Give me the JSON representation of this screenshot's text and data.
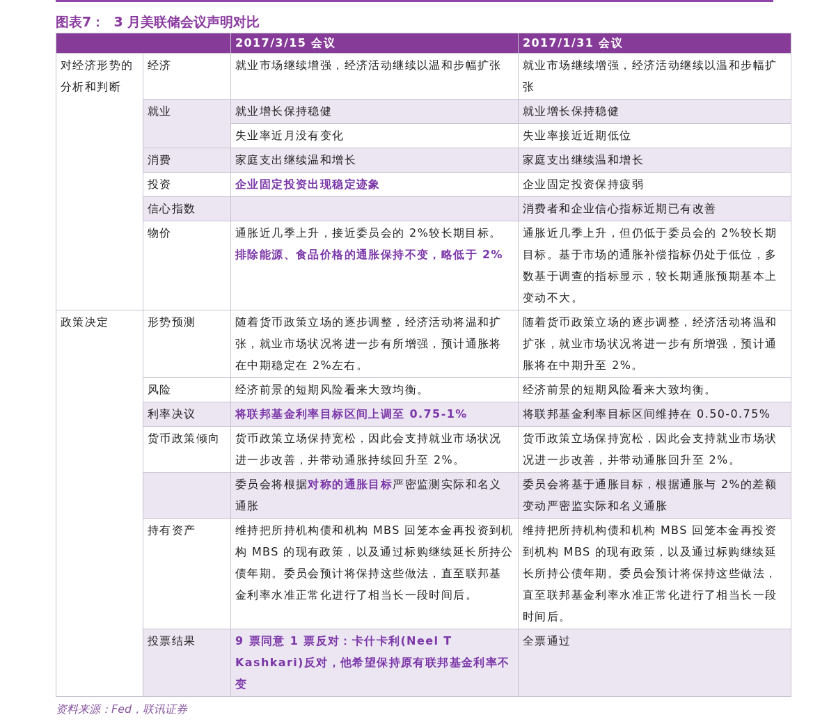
{
  "title": "图表7：  3 月美联储会议声明对比",
  "columns": [
    "2017/3/15 会议",
    "2017/1/31 会议"
  ],
  "groups": [
    {
      "label": "对经济形势的分析和判断",
      "topics": [
        {
          "label": "经济",
          "entries": [
            {
              "shaded": false,
              "cells": [
                {
                  "text": "就业市场继续增强，经济活动继续以温和步幅扩张",
                  "emphasis": false
                },
                {
                  "text": "就业市场继续增强，经济活动继续以温和步幅扩张",
                  "emphasis": false
                }
              ]
            }
          ]
        },
        {
          "label": "就业",
          "entries": [
            {
              "shaded": true,
              "cells": [
                {
                  "text": "就业增长保持稳健",
                  "emphasis": false
                },
                {
                  "text": "就业增长保持稳健",
                  "emphasis": false
                }
              ]
            },
            {
              "shaded": false,
              "cells": [
                {
                  "text": "失业率近月没有变化",
                  "emphasis": false
                },
                {
                  "text": "失业率接近近期低位",
                  "emphasis": false
                }
              ]
            }
          ]
        },
        {
          "label": "消费",
          "entries": [
            {
              "shaded": true,
              "cells": [
                {
                  "text": "家庭支出继续温和增长",
                  "emphasis": false
                },
                {
                  "text": "家庭支出继续温和增长",
                  "emphasis": false
                }
              ]
            }
          ]
        },
        {
          "label": "投资",
          "entries": [
            {
              "shaded": false,
              "cells": [
                {
                  "text": "企业固定投资出现稳定迹象",
                  "emphasis": true
                },
                {
                  "text": "企业固定投资保持疲弱",
                  "emphasis": false
                }
              ]
            }
          ]
        },
        {
          "label": "信心指数",
          "entries": [
            {
              "shaded": true,
              "cells": [
                {},
                {
                  "text": "消费者和企业信心指标近期已有改善",
                  "emphasis": false
                }
              ]
            }
          ]
        },
        {
          "label": "物价",
          "entries": [
            {
              "shaded": false,
              "cells": [
                {
                  "text": "通胀近几季上升，接近委员会的 2%较长期目标。**排除能源、食品价格的通胀保持不变，略低于 2%**",
                  "emphasis": false
                },
                {
                  "text": "通胀近几季上升，但仍低于委员会的 2%较长期目标。基于市场的通胀补偿指标仍处于低位，多数基于调查的指标显示，较长期通胀预期基本上变动不大。",
                  "emphasis": false
                }
              ]
            }
          ]
        }
      ]
    },
    {
      "label": "政策决定",
      "topics": [
        {
          "label": "形势预测",
          "entries": [
            {
              "shaded": false,
              "cells": [
                {
                  "text": "随着货币政策立场的逐步调整，经济活动将温和扩张，就业市场状况将进一步有所增强，预计通胀将在中期稳定在 2%左右。",
                  "emphasis": false
                },
                {
                  "text": "随着货币政策立场的逐步调整，经济活动将温和扩张，就业市场状况将进一步有所增强，预计通胀将在中期升至 2%。",
                  "emphasis": false
                }
              ]
            }
          ]
        },
        {
          "label": "风险",
          "entries": [
            {
              "shaded": false,
              "cells": [
                {
                  "text": "经济前景的短期风险看来大致均衡。",
                  "emphasis": false
                },
                {
                  "text": "经济前景的短期风险看来大致均衡。",
                  "emphasis": false
                }
              ]
            }
          ]
        },
        {
          "label": "利率决议",
          "entries": [
            {
              "shaded": true,
              "cells": [
                {
                  "text": "将联邦基金利率目标区间上调至 0.75-1%",
                  "emphasis": true
                },
                {
                  "text": "将联邦基金利率目标区间维持在 0.50-0.75%",
                  "emphasis": false
                }
              ]
            }
          ]
        },
        {
          "label": "货币政策倾向",
          "entries": [
            {
              "shaded": false,
              "cells": [
                {
                  "text": "货币政策立场保持宽松，因此会支持就业市场状况进一步改善，并带动通胀持续回升至 2%。",
                  "emphasis": false
                },
                {
                  "text": "货币政策立场保持宽松，因此会支持就业市场状况进一步改善，并带动通胀回升至 2%。",
                  "emphasis": false
                }
              ]
            }
          ]
        },
        {
          "entries": [
            {
              "shaded": true,
              "cells": [
                {
                  "text": "委员会将根据**对称的通胀目标**严密监测实际和名义通胀",
                  "emphasis": false
                },
                {
                  "text": "委员会将基于通胀目标，根据通胀与 2%的差额变动严密监实际和名义通胀",
                  "emphasis": false
                }
              ]
            }
          ]
        },
        {
          "label": "持有资产",
          "entries": [
            {
              "shaded": false,
              "cells": [
                {
                  "text": "维持把所持机构债和机构 MBS 回笼本金再投资到机构 MBS 的现有政策，以及通过标购继续延长所持公债年期。委员会预计将保持这些做法，直至联邦基金利率水准正常化进行了相当长一段时间后。",
                  "emphasis": false
                },
                {
                  "text": "维持把所持机构债和机构 MBS 回笼本金再投资到机构 MBS 的现有政策，以及通过标购继续延长所持公债年期。委员会预计将保持这些做法，直至联邦基金利率水准正常化进行了相当长一段时间后。",
                  "emphasis": false
                }
              ]
            }
          ]
        },
        {
          "label": "投票结果",
          "entries": [
            {
              "shaded": true,
              "cells": [
                {
                  "text": "9 票同意 1 票反对：卡什卡利(Neel T Kashkari)反对，他希望保持原有联邦基金利率不变",
                  "emphasis": true
                },
                {
                  "text": "全票通过",
                  "emphasis": false
                }
              ]
            }
          ]
        }
      ]
    }
  ],
  "source": "资料来源：Fed，联讯证券"
}
